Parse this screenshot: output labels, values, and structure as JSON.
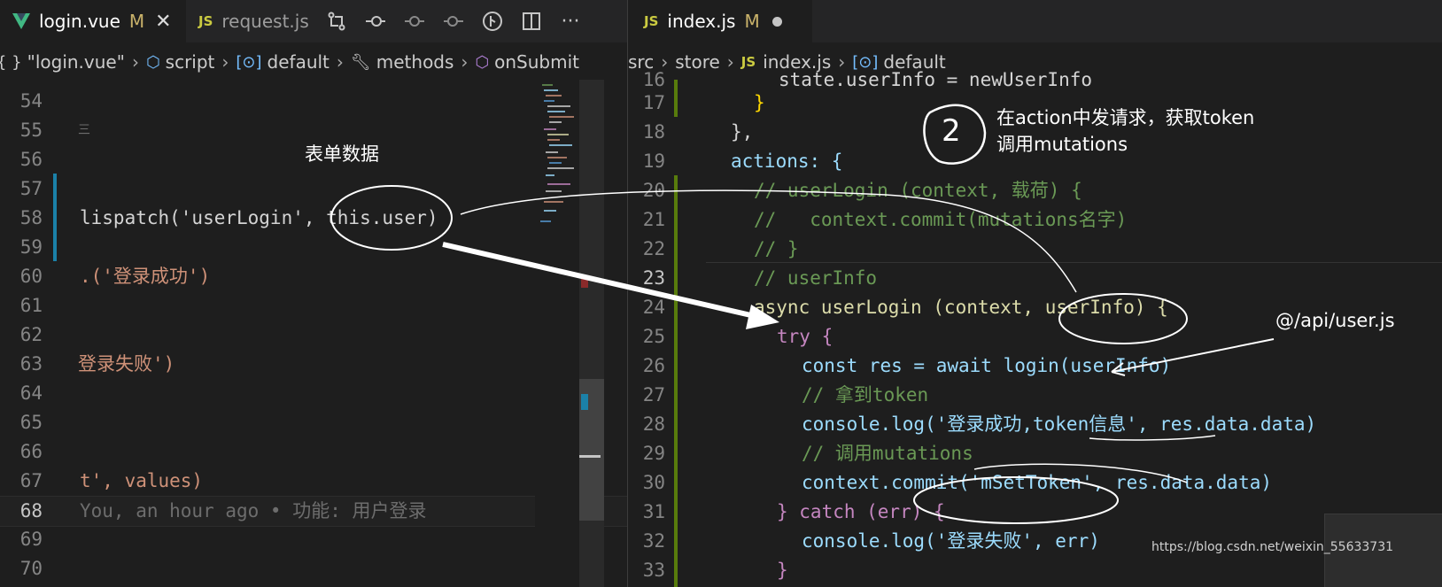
{
  "left": {
    "tabs": [
      {
        "label": "login.vue",
        "modified": "M",
        "icon": "vue-icon",
        "active": true
      },
      {
        "label": "request.js",
        "icon": "js-icon",
        "active": false
      }
    ],
    "breadcrumb": [
      {
        "label": "\"login.vue\"",
        "icon": "braces-icon"
      },
      {
        "label": "script",
        "icon": "cube-icon"
      },
      {
        "label": "default",
        "icon": "module-icon"
      },
      {
        "label": "methods",
        "icon": "wrench-icon"
      },
      {
        "label": "onSubmit",
        "icon": "method-icon"
      }
    ],
    "lines": [
      {
        "n": "54",
        "code": ""
      },
      {
        "n": "55",
        "code": "三"
      },
      {
        "n": "56",
        "code": ""
      },
      {
        "n": "57",
        "code": ""
      },
      {
        "n": "58",
        "code": "lispatch('userLogin', this.user)"
      },
      {
        "n": "59",
        "code": ""
      },
      {
        "n": "60",
        "code": ".('登录成功')"
      },
      {
        "n": "61",
        "code": ""
      },
      {
        "n": "62",
        "code": ""
      },
      {
        "n": "63",
        "code": "登录失败')"
      },
      {
        "n": "64",
        "code": ""
      },
      {
        "n": "65",
        "code": ""
      },
      {
        "n": "66",
        "code": ""
      },
      {
        "n": "67",
        "code": "t', values)"
      },
      {
        "n": "68",
        "code": "You, an hour ago • 功能: 用户登录"
      },
      {
        "n": "69",
        "code": ""
      },
      {
        "n": "70",
        "code": ""
      }
    ],
    "annotation_form_data": "表单数据"
  },
  "right": {
    "tabs": [
      {
        "label": "index.js",
        "modified": "M",
        "icon": "js-icon",
        "active": true
      }
    ],
    "breadcrumb": [
      {
        "label": "src"
      },
      {
        "label": "store"
      },
      {
        "label": "index.js",
        "icon": "js-icon"
      },
      {
        "label": "default",
        "icon": "module-icon"
      }
    ],
    "lines": [
      {
        "n": "16",
        "code": "state.userInfo = newUserInfo"
      },
      {
        "n": "17",
        "code": "}"
      },
      {
        "n": "18",
        "code": "},"
      },
      {
        "n": "19",
        "code": "actions: {"
      },
      {
        "n": "20",
        "code": "// userLogin (context, 载荷) {"
      },
      {
        "n": "21",
        "code": "//   context.commit(mutations名字)"
      },
      {
        "n": "22",
        "code": "// }"
      },
      {
        "n": "23",
        "code": "// userInfo"
      },
      {
        "n": "24",
        "code": "async userLogin (context, userInfo) {"
      },
      {
        "n": "25",
        "code": "try {"
      },
      {
        "n": "26",
        "code": "const res = await login(userInfo)"
      },
      {
        "n": "27",
        "code": "// 拿到token"
      },
      {
        "n": "28",
        "code": "console.log('登录成功,token信息', res.data.data)"
      },
      {
        "n": "29",
        "code": "// 调用mutations"
      },
      {
        "n": "30",
        "code": "context.commit('mSetToken', res.data.data)"
      },
      {
        "n": "31",
        "code": "} catch (err) {"
      },
      {
        "n": "32",
        "code": "console.log('登录失败', err)"
      },
      {
        "n": "33",
        "code": "}"
      }
    ],
    "annotation_step": "2",
    "annotation_line1": "在action中发请求，获取token",
    "annotation_line2": "调用mutations",
    "annotation_api": "@/api/user.js"
  },
  "watermark": "https://blog.csdn.net/weixin_55633731",
  "colors": {
    "accent_modified": "#c9b26a",
    "gutter_modified": "#1b81a8",
    "gutter_added": "#587c0c"
  }
}
